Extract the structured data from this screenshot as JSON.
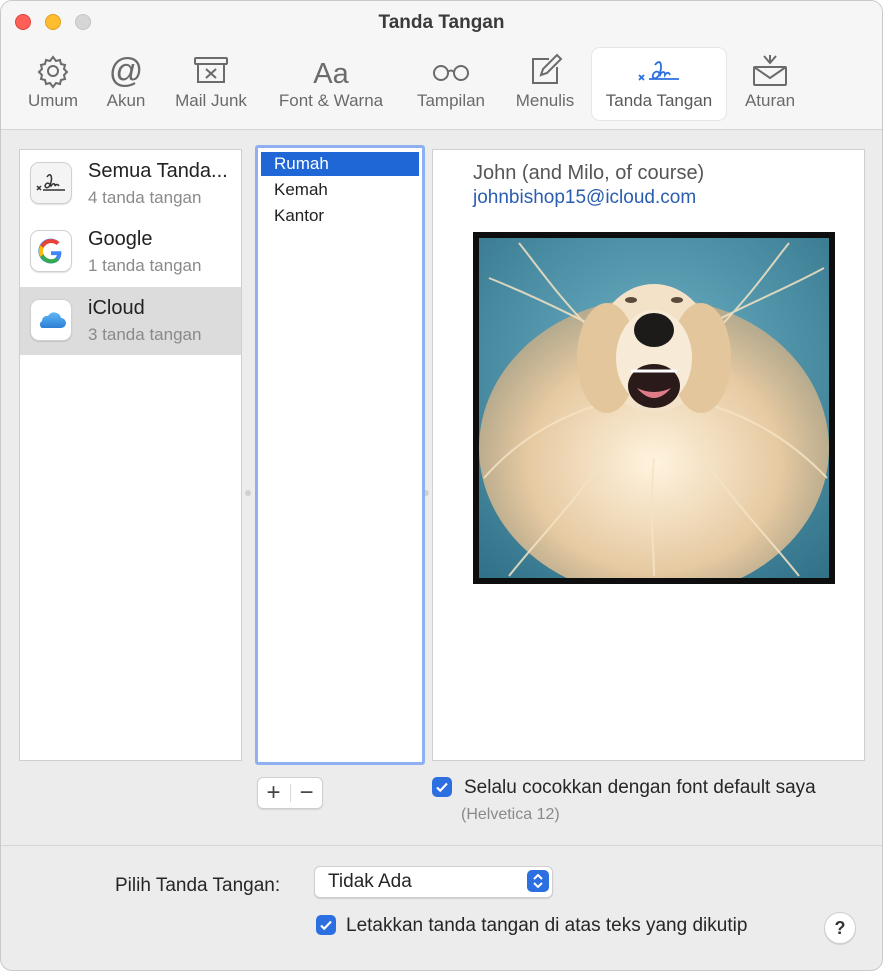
{
  "window": {
    "title": "Tanda Tangan"
  },
  "toolbar": {
    "items": [
      {
        "label": "Umum",
        "icon": "gear-icon"
      },
      {
        "label": "Akun",
        "icon": "at-icon"
      },
      {
        "label": "Mail Junk",
        "icon": "junk-tray-icon"
      },
      {
        "label": "Font & Warna",
        "icon": "font-icon"
      },
      {
        "label": "Tampilan",
        "icon": "glasses-icon"
      },
      {
        "label": "Menulis",
        "icon": "compose-icon"
      },
      {
        "label": "Tanda Tangan",
        "icon": "signature-icon",
        "active": true
      },
      {
        "label": "Aturan",
        "icon": "rules-envelope-icon"
      }
    ]
  },
  "accounts": [
    {
      "name": "Semua Tanda...",
      "count": "4 tanda tangan",
      "icon": "signature-icon"
    },
    {
      "name": "Google",
      "count": "1 tanda tangan",
      "icon": "google-icon"
    },
    {
      "name": "iCloud",
      "count": "3 tanda tangan",
      "icon": "icloud-icon",
      "selected": true
    }
  ],
  "signatures": [
    {
      "label": "Rumah",
      "selected": true
    },
    {
      "label": "Kemah"
    },
    {
      "label": "Kantor"
    }
  ],
  "preview": {
    "name_line": "John (and Milo, of course)",
    "email": "johnbishop15@icloud.com",
    "image": "dog-photo"
  },
  "buttons": {
    "add": "+",
    "remove": "−",
    "help": "?"
  },
  "options": {
    "match_font_label": "Selalu cocokkan dengan font default saya",
    "match_font_checked": true,
    "font_hint": "(Helvetica 12)",
    "choose_label": "Pilih Tanda Tangan:",
    "choose_value": "Tidak Ada",
    "place_above_label": "Letakkan tanda tangan di atas teks yang dikutip",
    "place_above_checked": true
  },
  "colors": {
    "accent": "#2b6fe0",
    "selection": "#1f66d6",
    "link": "#2a5db0"
  }
}
